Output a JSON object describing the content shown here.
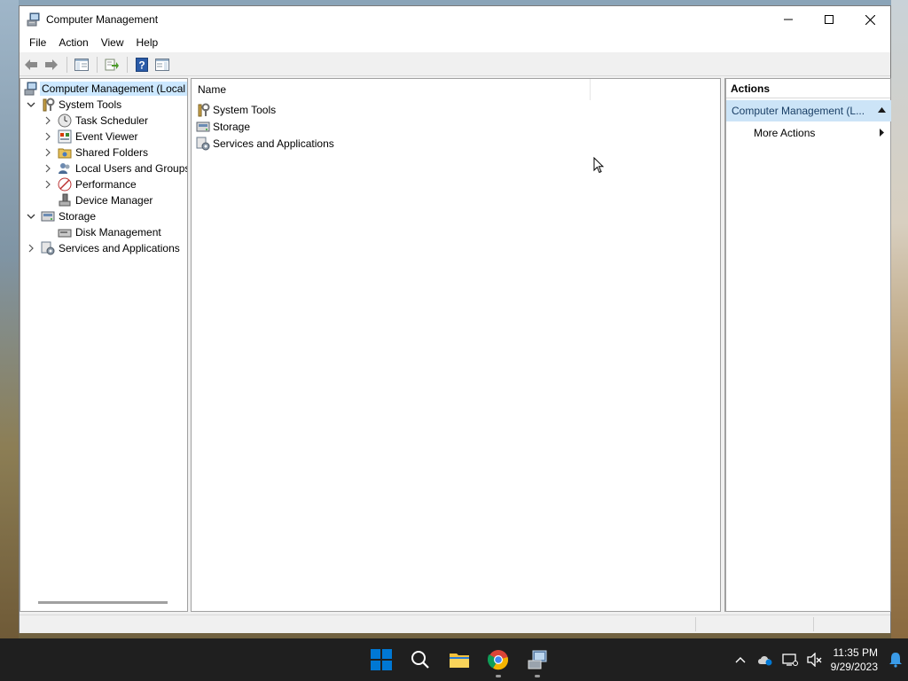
{
  "window": {
    "title": "Computer Management"
  },
  "menu": [
    "File",
    "Action",
    "View",
    "Help"
  ],
  "tree": {
    "root": "Computer Management (Local",
    "system_tools": "System Tools",
    "task_scheduler": "Task Scheduler",
    "event_viewer": "Event Viewer",
    "shared_folders": "Shared Folders",
    "local_users": "Local Users and Groups",
    "performance": "Performance",
    "device_manager": "Device Manager",
    "storage": "Storage",
    "disk_management": "Disk Management",
    "services": "Services and Applications"
  },
  "list": {
    "column_name": "Name",
    "items": [
      "System Tools",
      "Storage",
      "Services and Applications"
    ]
  },
  "actions": {
    "header": "Actions",
    "selected": "Computer Management (L...",
    "more": "More Actions"
  },
  "taskbar": {
    "time": "11:35 PM",
    "date": "9/29/2023"
  },
  "colors": {
    "selection": "#cce8ff",
    "actions_selection": "#cce4f7",
    "taskbar": "#1f1f1f",
    "windows_blue": "#0078d4"
  }
}
